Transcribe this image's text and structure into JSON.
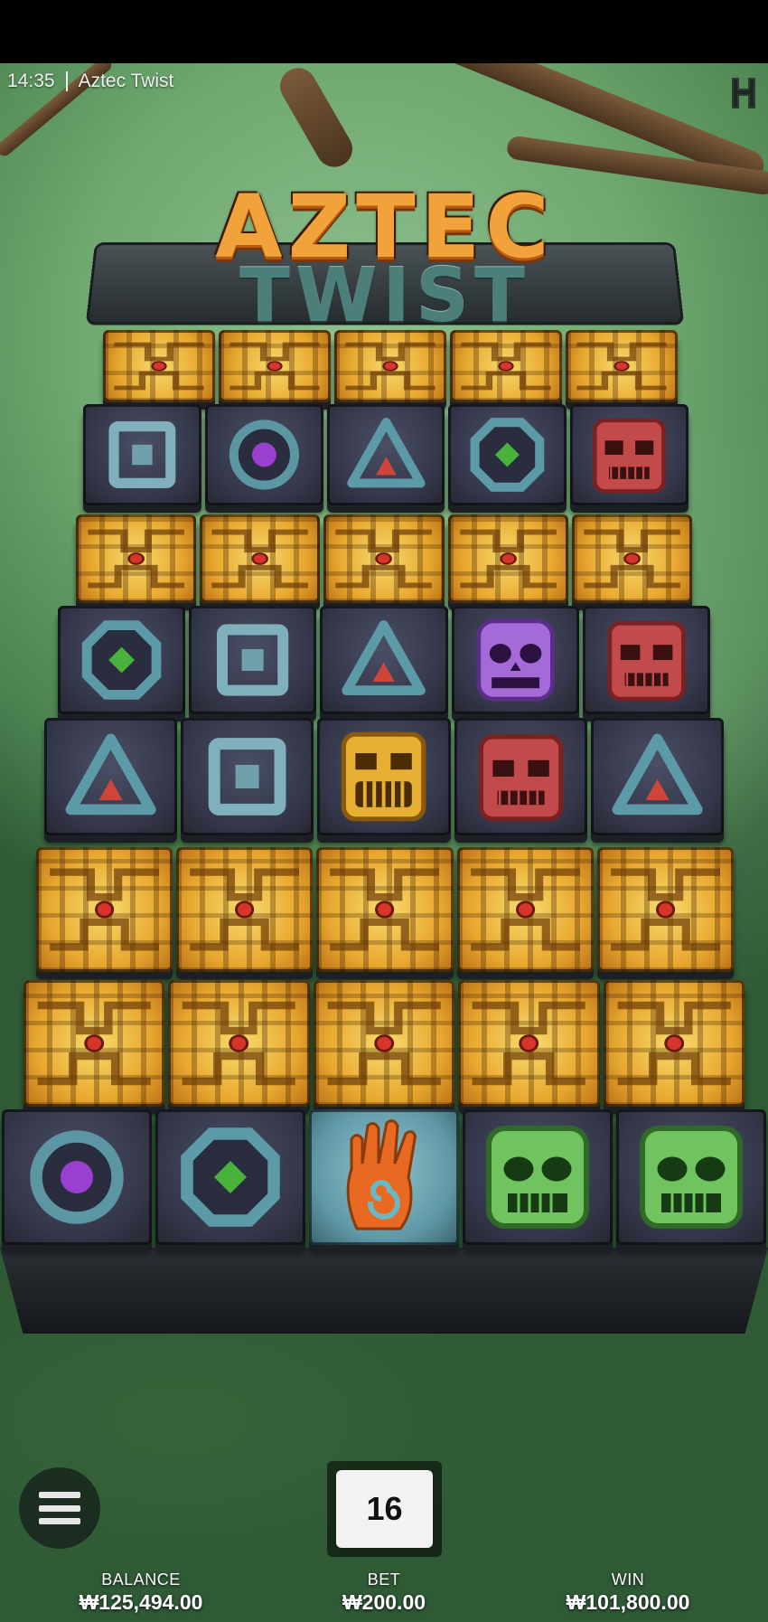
{
  "status_bar": {
    "time": "14:35",
    "app_title": "Aztec Twist"
  },
  "game_logo": {
    "line1": "AZTEC",
    "line2": "TWIST"
  },
  "symbols": [
    "square-rune",
    "circle-purple-gem",
    "triangle-red-gem",
    "octagon-green-gem",
    "red-skull-mask",
    "purple-skull-mask",
    "gold-skull-mask",
    "green-skull-mask",
    "hand-spiral-wild",
    "gold-calendar-block"
  ],
  "grid": {
    "columns": 5,
    "rows": [
      [
        "gold-calendar-block",
        "gold-calendar-block",
        "gold-calendar-block",
        "gold-calendar-block",
        "gold-calendar-block"
      ],
      [
        "square-rune",
        "circle-purple-gem",
        "triangle-red-gem",
        "octagon-green-gem",
        "red-skull-mask"
      ],
      [
        "gold-calendar-block",
        "gold-calendar-block",
        "gold-calendar-block",
        "gold-calendar-block",
        "gold-calendar-block"
      ],
      [
        "octagon-green-gem",
        "square-rune",
        "triangle-red-gem",
        "purple-skull-mask",
        "red-skull-mask"
      ],
      [
        "triangle-red-gem",
        "square-rune",
        "gold-skull-mask",
        "red-skull-mask",
        "triangle-red-gem"
      ],
      [
        "gold-calendar-block",
        "gold-calendar-block",
        "gold-calendar-block",
        "gold-calendar-block",
        "gold-calendar-block"
      ],
      [
        "gold-calendar-block",
        "gold-calendar-block",
        "gold-calendar-block",
        "gold-calendar-block",
        "gold-calendar-block"
      ],
      [
        "circle-purple-gem",
        "octagon-green-gem",
        "hand-spiral-wild",
        "green-skull-mask",
        "green-skull-mask"
      ]
    ]
  },
  "controls": {
    "menu_icon": "hamburger-menu-icon",
    "spin_count": "16"
  },
  "stats": {
    "balance_label": "BALANCE",
    "balance_value": "₩125,494.00",
    "bet_label": "BET",
    "bet_value": "₩200.00",
    "win_label": "WIN",
    "win_value": "₩101,800.00"
  },
  "colors": {
    "accent_gold": "#f2a23a",
    "stone": "#34374a",
    "teal": "#5aa3ad"
  }
}
